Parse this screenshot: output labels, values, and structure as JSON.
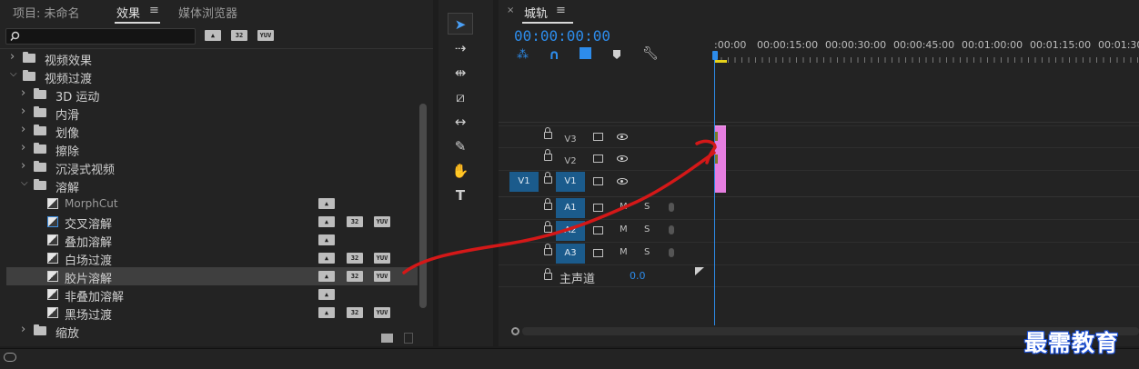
{
  "effects_panel": {
    "tabs": [
      {
        "label": "项目: 未命名"
      },
      {
        "label": "效果"
      },
      {
        "label": "媒体浏览器"
      }
    ],
    "badges": [
      "32",
      "YUV"
    ],
    "tree": [
      {
        "label": "视频效果",
        "kind": "folder",
        "expanded": false,
        "level": 0
      },
      {
        "label": "视频过渡",
        "kind": "folder",
        "expanded": true,
        "level": 0
      },
      {
        "label": "3D 运动",
        "kind": "folder",
        "expanded": false,
        "level": 1
      },
      {
        "label": "内滑",
        "kind": "folder",
        "expanded": false,
        "level": 1
      },
      {
        "label": "划像",
        "kind": "folder",
        "expanded": false,
        "level": 1
      },
      {
        "label": "擦除",
        "kind": "folder",
        "expanded": false,
        "level": 1
      },
      {
        "label": "沉浸式视频",
        "kind": "folder",
        "expanded": false,
        "level": 1
      },
      {
        "label": "溶解",
        "kind": "folder",
        "expanded": true,
        "level": 1
      },
      {
        "label": "MorphCut",
        "kind": "transition",
        "badges": [
          "accel"
        ]
      },
      {
        "label": "交叉溶解",
        "kind": "transition",
        "badges": [
          "accel",
          "32",
          "YUV"
        ]
      },
      {
        "label": "叠加溶解",
        "kind": "transition",
        "badges": [
          "accel"
        ]
      },
      {
        "label": "白场过渡",
        "kind": "transition",
        "badges": [
          "accel",
          "32",
          "YUV"
        ]
      },
      {
        "label": "胶片溶解",
        "kind": "transition",
        "badges": [
          "accel",
          "32",
          "YUV"
        ],
        "selected": true
      },
      {
        "label": "非叠加溶解",
        "kind": "transition",
        "badges": [
          "accel"
        ]
      },
      {
        "label": "黑场过渡",
        "kind": "transition",
        "badges": [
          "accel",
          "32",
          "YUV"
        ]
      },
      {
        "label": "缩放",
        "kind": "folder",
        "expanded": false,
        "level": 1
      }
    ]
  },
  "timeline": {
    "tab_title": "城轨",
    "timecode": "00:00:00:00",
    "ruler": [
      ":00:00",
      "00:00:15:00",
      "00:00:30:00",
      "00:00:45:00",
      "00:01:00:00",
      "00:01:15:00",
      "00:01:30"
    ],
    "video_tracks": [
      {
        "name": "V3",
        "source": ""
      },
      {
        "name": "V2",
        "source": ""
      },
      {
        "name": "V1",
        "source": "V1"
      }
    ],
    "audio_tracks": [
      {
        "name": "A1",
        "m": "M",
        "s": "S"
      },
      {
        "name": "A2",
        "m": "M",
        "s": "S"
      },
      {
        "name": "A3",
        "m": "M",
        "s": "S"
      }
    ],
    "master": {
      "label": "主声道",
      "value": "0.0"
    }
  },
  "watermark": "最需教育",
  "colors": {
    "accent_blue": "#2d8ceb",
    "clip_pink": "#e67ee0",
    "annotation_red": "#d41818",
    "track_highlight": "#1b5b8c"
  }
}
